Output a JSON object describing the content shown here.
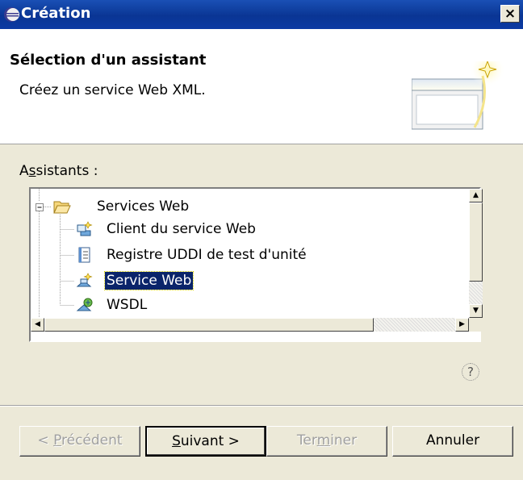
{
  "window": {
    "title": "Création",
    "close_glyph": "×"
  },
  "header": {
    "title": "Sélection d'un assistant",
    "description": "Créez un service Web XML."
  },
  "wizards": {
    "label_prefix": "A",
    "label_mnemonic": "s",
    "label_rest": "sistants :",
    "tree": [
      {
        "label": "Services Web",
        "icon": "folder-open-icon",
        "level": 0,
        "expanded": true
      },
      {
        "label": "Client du service Web",
        "icon": "web-service-client-icon",
        "level": 1
      },
      {
        "label": "Registre UDDI de test d'unité",
        "icon": "document-icon",
        "level": 1
      },
      {
        "label": "Service Web",
        "icon": "web-service-icon",
        "level": 1,
        "selected": true
      },
      {
        "label": "WSDL",
        "icon": "wsdl-icon",
        "level": 1
      }
    ]
  },
  "help": {
    "glyph": "?"
  },
  "buttons": {
    "previous": {
      "pre": "< ",
      "mn": "P",
      "post": "récédent",
      "enabled": false
    },
    "next": {
      "pre": "",
      "mn": "S",
      "post": "uivant >",
      "enabled": true
    },
    "finish": {
      "pre": "Ter",
      "mn": "m",
      "post": "iner",
      "enabled": false
    },
    "cancel": {
      "label": "Annuler",
      "enabled": true
    }
  },
  "colors": {
    "titlebar": "#0a3594",
    "selection": "#0a246a",
    "dialog_bg": "#ece9d8"
  }
}
